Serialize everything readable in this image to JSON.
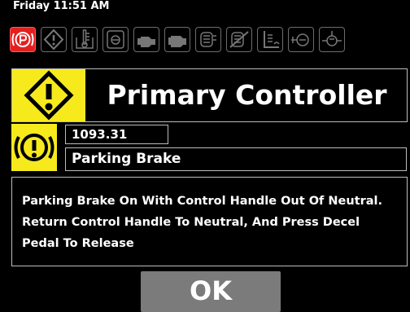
{
  "status_bar": {
    "datetime": "Friday 11:51 AM"
  },
  "indicators": [
    {
      "name": "parking-brake-icon",
      "active": true,
      "color": "#e41f1f"
    },
    {
      "name": "warning-icon",
      "active": false
    },
    {
      "name": "coolant-temperature-icon",
      "active": false
    },
    {
      "name": "air-filter-icon",
      "active": false
    },
    {
      "name": "engine-icon",
      "active": false
    },
    {
      "name": "engine-alt-icon",
      "active": false
    },
    {
      "name": "transmission-temperature-icon",
      "active": false
    },
    {
      "name": "transmission-fault-icon",
      "active": false
    },
    {
      "name": "hydraulic-oil-level-icon",
      "active": false
    },
    {
      "name": "hydraulic-filter-icon",
      "active": false
    },
    {
      "name": "hydraulic-pressure-icon",
      "active": false
    }
  ],
  "alarm": {
    "title": "Primary Controller",
    "code": "1093.31",
    "name": "Parking Brake",
    "message": "Parking Brake On With Control Handle Out Of Neutral. Return Control Handle To Neutral, And Press Decel Pedal To Release"
  },
  "ok_button": {
    "label": "OK"
  },
  "colors": {
    "warning_yellow": "#f6ea1c",
    "alert_red": "#e41f1f",
    "button_gray": "#7b7b7b"
  }
}
